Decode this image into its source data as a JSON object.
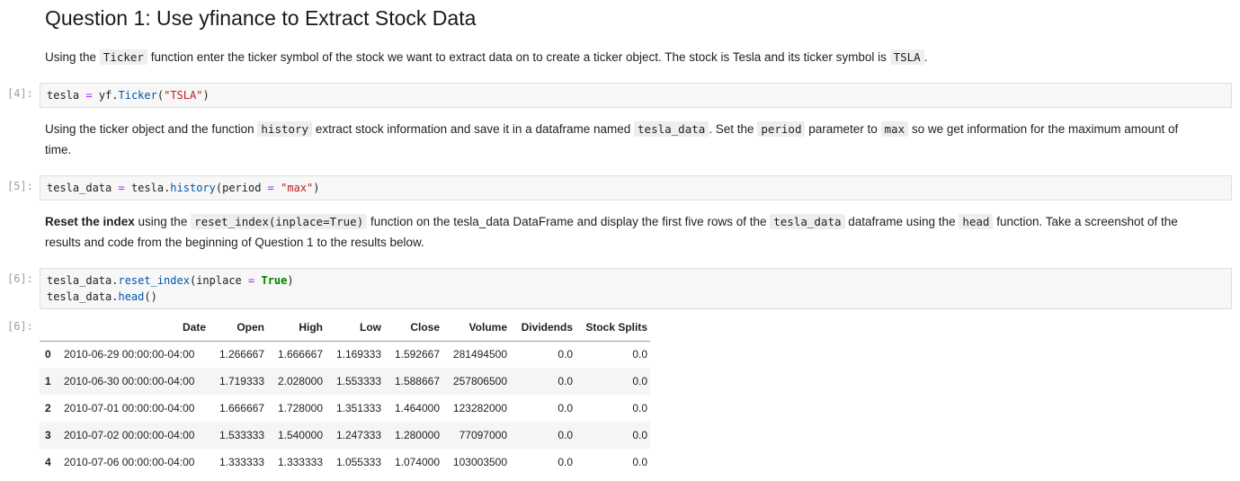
{
  "title": "Question 1: Use yfinance to Extract Stock Data",
  "para1": {
    "t1": "Using the ",
    "c1": "Ticker",
    "t2": " function enter the ticker symbol of the stock we want to extract data on to create a ticker object. The stock is Tesla and its ticker symbol is ",
    "c2": "TSLA",
    "t3": "."
  },
  "cell1": {
    "prompt": "[4]:",
    "tokens": [
      "tesla ",
      "=",
      " yf.",
      "Ticker",
      "(",
      "\"TSLA\"",
      ")"
    ]
  },
  "para2": {
    "t1": "Using the ticker object and the function ",
    "c1": "history",
    "t2": " extract stock information and save it in a dataframe named ",
    "c2": "tesla_data",
    "t3": ". Set the ",
    "c3": "period",
    "t4": " parameter to ",
    "c4": "max",
    "t5": " so we get information for the maximum amount of time."
  },
  "cell2": {
    "prompt": "[5]:",
    "tokens": [
      "tesla_data ",
      "=",
      " tesla.",
      "history",
      "(period ",
      "=",
      " ",
      "\"max\"",
      ")"
    ]
  },
  "para3": {
    "b1": "Reset the index",
    "t1": " using the ",
    "c1": "reset_index(inplace=True)",
    "t2": " function on the tesla_data DataFrame and display the first five rows of the ",
    "c2": "tesla_data",
    "t3": " dataframe using the ",
    "c3": "head",
    "t4": " function. Take a screenshot of the results and code from the beginning of Question 1 to the results below."
  },
  "cell3": {
    "prompt": "[6]:",
    "line1": [
      "tesla_data.",
      "reset_index",
      "(inplace ",
      "=",
      " ",
      "True",
      ")"
    ],
    "line2": [
      "tesla_data.",
      "head",
      "()"
    ]
  },
  "output": {
    "prompt": "[6]:",
    "columns": [
      "",
      "Date",
      "Open",
      "High",
      "Low",
      "Close",
      "Volume",
      "Dividends",
      "Stock Splits"
    ],
    "rows": [
      [
        "0",
        "2010-06-29 00:00:00-04:00",
        "1.266667",
        "1.666667",
        "1.169333",
        "1.592667",
        "281494500",
        "0.0",
        "0.0"
      ],
      [
        "1",
        "2010-06-30 00:00:00-04:00",
        "1.719333",
        "2.028000",
        "1.553333",
        "1.588667",
        "257806500",
        "0.0",
        "0.0"
      ],
      [
        "2",
        "2010-07-01 00:00:00-04:00",
        "1.666667",
        "1.728000",
        "1.351333",
        "1.464000",
        "123282000",
        "0.0",
        "0.0"
      ],
      [
        "3",
        "2010-07-02 00:00:00-04:00",
        "1.533333",
        "1.540000",
        "1.247333",
        "1.280000",
        "77097000",
        "0.0",
        "0.0"
      ],
      [
        "4",
        "2010-07-06 00:00:00-04:00",
        "1.333333",
        "1.333333",
        "1.055333",
        "1.074000",
        "103003500",
        "0.0",
        "0.0"
      ]
    ]
  }
}
